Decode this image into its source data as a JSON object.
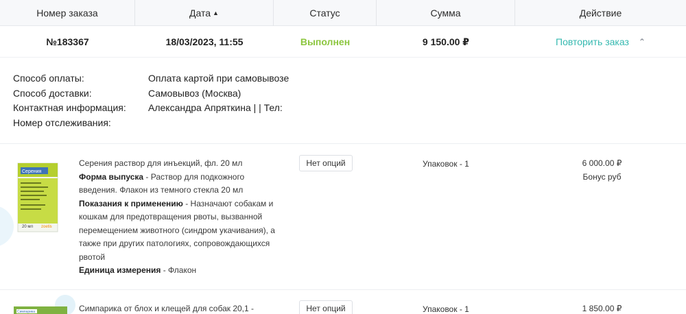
{
  "table": {
    "headers": [
      {
        "label": "Номер заказа",
        "sortable": false
      },
      {
        "label": "Дата",
        "sort": "asc"
      },
      {
        "label": "Статус"
      },
      {
        "label": "Сумма"
      },
      {
        "label": "Действие"
      }
    ],
    "order": {
      "number": "№183367",
      "date": "18/03/2023, 11:55",
      "status": "Выполнен",
      "sum": "9 150.00 ₽",
      "action": "Повторить заказ"
    }
  },
  "details": [
    {
      "label": "Способ оплаты:",
      "value": "Оплата картой при самовывозе"
    },
    {
      "label": "Способ доставки:",
      "value": "Самовывоз (Москва)"
    },
    {
      "label": "Контактная информация:",
      "value": "Александра Апряткина | | Тел:"
    },
    {
      "label": "Номер отслеживания:",
      "value": ""
    }
  ],
  "products": [
    {
      "title": "Серения раствор для инъекций, фл. 20 мл",
      "form_label": "Форма выпуска",
      "form_value": " - Раствор для подкожного введения. Флакон из темного стекла 20 мл",
      "indications_label": "Показания к применению",
      "indications_value": " - Назначают собакам и кошкам для предотвращения рвоты, вызванной перемещением животного (синдром укачивания), а также при других патологиях, сопровождающихся рвотой",
      "unit_label": "Единица измерения",
      "unit_value": " - Флакон",
      "options": "Нет опций",
      "packs": "Упаковок - 1",
      "price": "6 000.00 ₽",
      "bonus": "Бонус руб",
      "image_brand": "Серения",
      "image_maker": "zoetis",
      "image_volume": "20 мл"
    },
    {
      "title": "Симпарика от блох и клещей для собак 20,1 -",
      "options": "Нет опций",
      "packs": "Упаковок - 1",
      "price": "1 850.00 ₽",
      "image_brand": "Симпарика"
    }
  ],
  "colors": {
    "status": "#8cc63f",
    "action": "#35b9b0",
    "header_bg": "#f7f8fa",
    "product_green": "#b5cf2e"
  }
}
